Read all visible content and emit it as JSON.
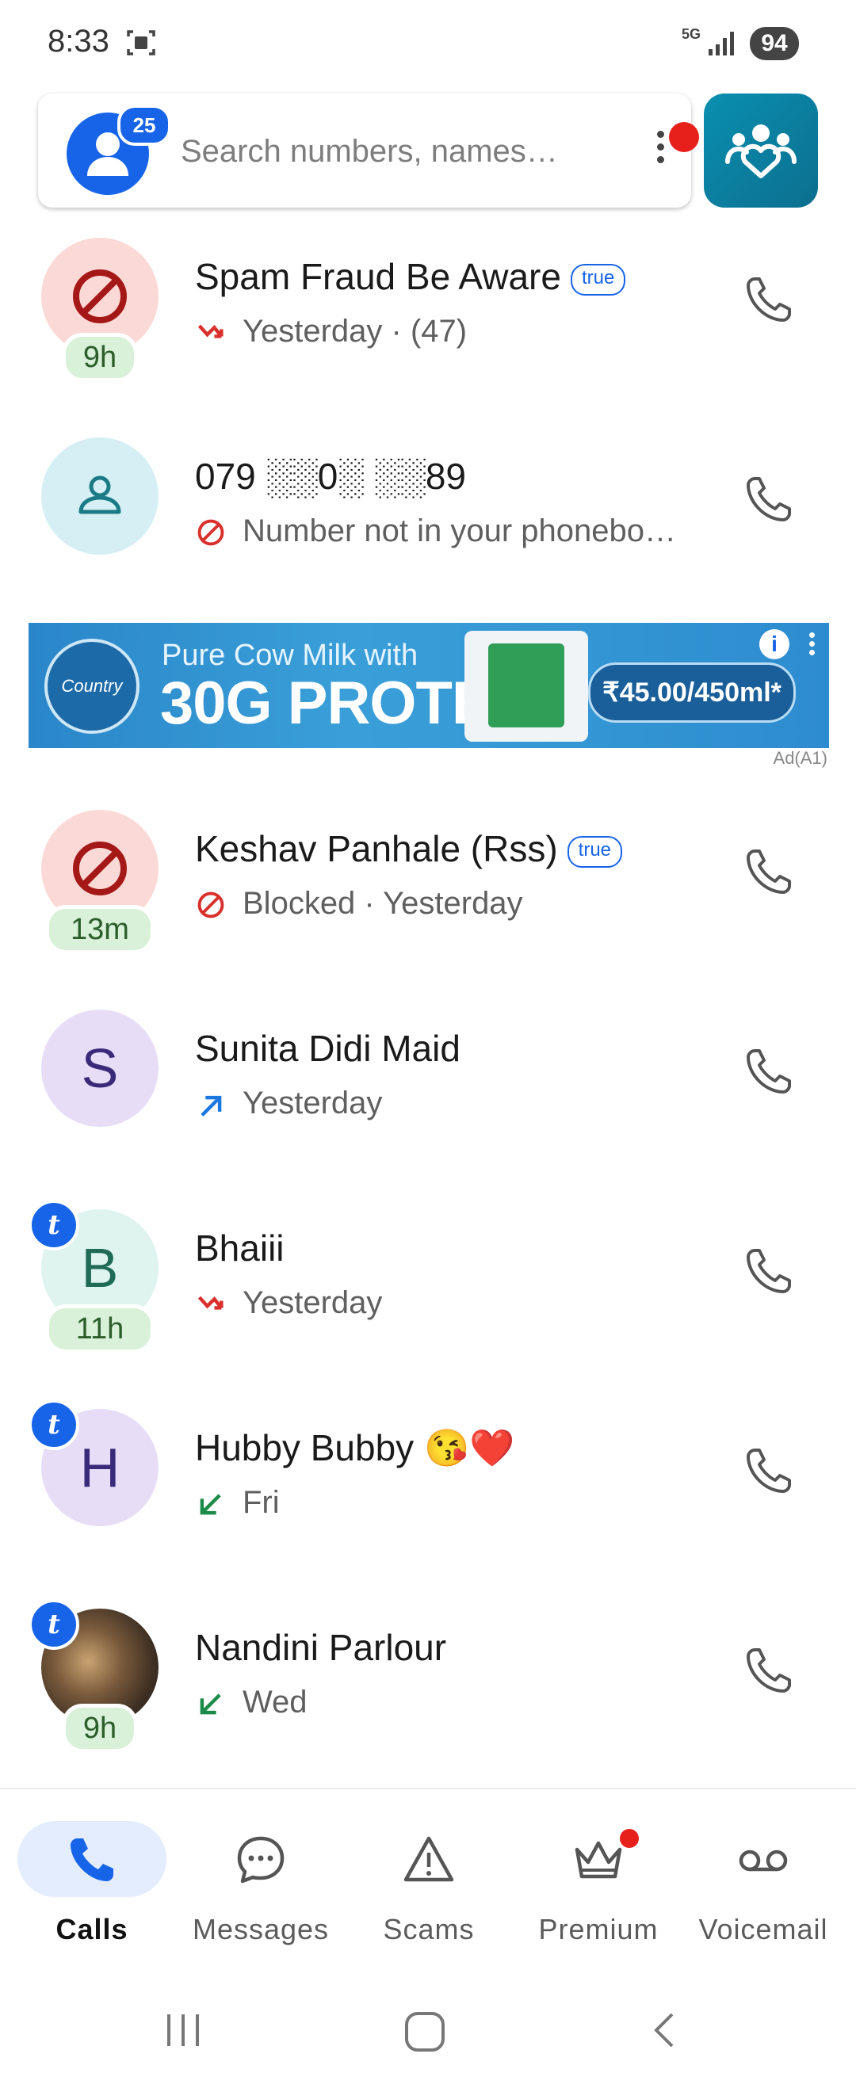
{
  "status_bar": {
    "time": "8:33",
    "network": "5G",
    "battery": "94"
  },
  "search": {
    "placeholder": "Search numbers, names…",
    "notification_count": "25"
  },
  "calls": [
    {
      "name": "Spam Fraud Be Aware",
      "verified_badge": "true",
      "detail": "Yesterday · (47)",
      "call_type": "missed",
      "avatar": "block-icon",
      "avatar_letter": "",
      "time_pill": "9h",
      "tag": false
    },
    {
      "name": "079 ░░0░ ░░89",
      "verified_badge": "",
      "detail": "Number not in your phonebo…",
      "call_type": "blocked",
      "avatar": "person-icon",
      "avatar_letter": "",
      "time_pill": "",
      "tag": false
    },
    {
      "name": "Keshav Panhale (Rss)",
      "verified_badge": "true",
      "detail": "Blocked · Yesterday",
      "call_type": "blocked",
      "avatar": "block-icon",
      "avatar_letter": "",
      "time_pill": "13m",
      "tag": false
    },
    {
      "name": "Sunita Didi Maid",
      "verified_badge": "",
      "detail": "Yesterday",
      "call_type": "outgoing",
      "avatar": "letter",
      "avatar_letter": "S",
      "time_pill": "",
      "tag": false
    },
    {
      "name": "Bhaiii",
      "verified_badge": "",
      "detail": "Yesterday",
      "call_type": "missed",
      "avatar": "letter",
      "avatar_letter": "B",
      "time_pill": "11h",
      "tag": true
    },
    {
      "name": "Hubby Bubby 😘❤️",
      "verified_badge": "",
      "detail": "Fri",
      "call_type": "incoming",
      "avatar": "letter",
      "avatar_letter": "H",
      "time_pill": "",
      "tag": true
    },
    {
      "name": "Nandini Parlour",
      "verified_badge": "",
      "detail": "Wed",
      "call_type": "incoming",
      "avatar": "photo",
      "avatar_letter": "",
      "time_pill": "9h",
      "tag": true
    }
  ],
  "ad": {
    "line1": "Pure Cow Milk with",
    "line2": "30G PROTEIN",
    "price": "₹45.00/450ml*",
    "logo_text": "Country Delight",
    "label": "Ad(A1)",
    "info": "i"
  },
  "tag_letter": "t",
  "nav": [
    {
      "label": "Calls",
      "icon": "phone-icon",
      "active": true
    },
    {
      "label": "Messages",
      "icon": "chat-icon",
      "active": false
    },
    {
      "label": "Scams",
      "icon": "warning-icon",
      "active": false
    },
    {
      "label": "Premium",
      "icon": "crown-icon",
      "active": false
    },
    {
      "label": "Voicemail",
      "icon": "voicemail-icon",
      "active": false
    }
  ],
  "colors": {
    "accent": "#1764e8",
    "missed": "#d9302c",
    "outgoing": "#1a78e0",
    "incoming": "#1c8a48",
    "spam_bg": "#fbd9d6",
    "spam_icon": "#a51818"
  }
}
